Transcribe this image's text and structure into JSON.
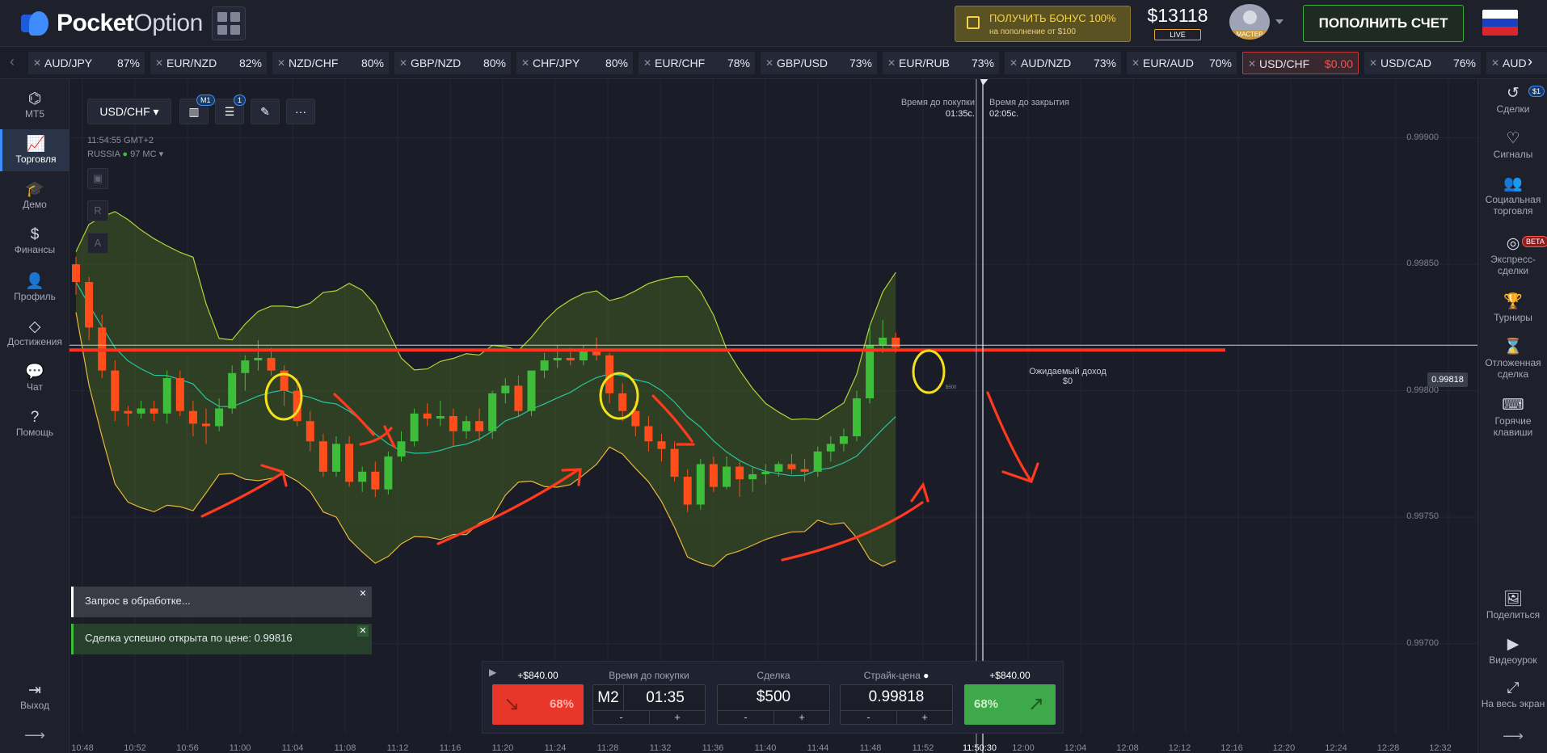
{
  "header": {
    "brand_bold": "Pocket",
    "brand_light": "Option",
    "bonus_line1": "ПОЛУЧИТЬ БОНУС 100%",
    "bonus_line2": "на пополнение от $100",
    "balance": "$13118",
    "account_type": "LIVE",
    "level": "МАСТЕР",
    "deposit_label": "ПОПОЛНИТЬ СЧЕТ"
  },
  "tickers": [
    {
      "pair": "AUD/JPY",
      "payout": "87%"
    },
    {
      "pair": "EUR/NZD",
      "payout": "82%"
    },
    {
      "pair": "NZD/CHF",
      "payout": "80%"
    },
    {
      "pair": "GBP/NZD",
      "payout": "80%"
    },
    {
      "pair": "CHF/JPY",
      "payout": "80%"
    },
    {
      "pair": "EUR/CHF",
      "payout": "78%"
    },
    {
      "pair": "GBP/USD",
      "payout": "73%"
    },
    {
      "pair": "EUR/RUB",
      "payout": "73%"
    },
    {
      "pair": "AUD/NZD",
      "payout": "73%"
    },
    {
      "pair": "EUR/AUD",
      "payout": "70%"
    },
    {
      "pair": "USD/CHF",
      "payout": "$0.00"
    },
    {
      "pair": "USD/CAD",
      "payout": "76%"
    },
    {
      "pair": "AUD",
      "payout": ""
    }
  ],
  "left_nav": [
    {
      "icon": "mt5-icon",
      "label": "MT5"
    },
    {
      "icon": "chart-icon",
      "label": "Торговля"
    },
    {
      "icon": "demo-icon",
      "label": "Демо"
    },
    {
      "icon": "dollar-icon",
      "label": "Финансы"
    },
    {
      "icon": "user-icon",
      "label": "Профиль"
    },
    {
      "icon": "diamond-icon",
      "label": "Достижения"
    },
    {
      "icon": "chat-icon",
      "label": "Чат"
    },
    {
      "icon": "help-icon",
      "label": "Помощь"
    },
    {
      "icon": "exit-icon",
      "label": "Выход"
    }
  ],
  "right_nav": [
    {
      "icon": "history-icon",
      "label": "Сделки"
    },
    {
      "icon": "signals-icon",
      "label": "Сигналы"
    },
    {
      "icon": "social-icon",
      "label": "Социальная торговля"
    },
    {
      "icon": "express-icon",
      "label": "Экспресс-сделки"
    },
    {
      "icon": "trophy-icon",
      "label": "Турниры"
    },
    {
      "icon": "hourglass-icon",
      "label": "Отложенная сделка"
    },
    {
      "icon": "keyboard-icon",
      "label": "Горячие клавиши"
    },
    {
      "icon": "share-icon",
      "label": "Поделиться"
    },
    {
      "icon": "video-icon",
      "label": "Видеоурок"
    },
    {
      "icon": "fullscreen-icon",
      "label": "На весь экран"
    }
  ],
  "badges": {
    "deals": "$1",
    "express": "BETA",
    "timeframe": "M1",
    "indicators": "1"
  },
  "chart": {
    "symbol": "USD/CHF",
    "server_time": "11:54:55 GMT+2",
    "region": "RUSSIA",
    "ping": "97 МС",
    "buy_time_label": "Время до покупки",
    "buy_time": "01:35с.",
    "close_time_label": "Время до закрытия",
    "close_time": "02:05с.",
    "expected_label": "Ожидаемый доход",
    "expected_value": "$0",
    "current_price": "0.99818",
    "price_ticks": [
      "0.99900",
      "0.99850",
      "0.99800",
      "0.99750",
      "0.99700"
    ],
    "time_ticks": [
      "10:48",
      "10:52",
      "10:56",
      "11:00",
      "11:04",
      "11:08",
      "11:12",
      "11:16",
      "11:20",
      "11:24",
      "11:28",
      "11:32",
      "11:36",
      "11:40",
      "11:44",
      "11:48",
      "11:52",
      "11:50:30",
      "12:00",
      "12:04",
      "12:08",
      "12:12",
      "12:16",
      "12:20",
      "12:24",
      "12:28",
      "12:32"
    ],
    "side_buttons": [
      "R",
      "A"
    ],
    "deal_marker": "$500"
  },
  "notifications": {
    "processing": "Запрос в обработке...",
    "success": "Сделка успешно открыта по цене: 0.99816"
  },
  "trade_panel": {
    "sell_profit": "+$840.00",
    "buy_profit": "+$840.00",
    "sell_pct": "68%",
    "buy_pct": "68%",
    "time_label": "Время до покупки",
    "timeframe": "M2",
    "time_value": "01:35",
    "amount_label": "Сделка",
    "amount": "$500",
    "strike_label": "Страйк-цена",
    "strike": "0.99818",
    "minus": "-",
    "plus": "+"
  },
  "colors": {
    "up": "#3ebd3a",
    "down": "#ff4e1c",
    "band": "#4a6a22",
    "bandline": "#b5d33a",
    "midline": "#27c7a0",
    "annotation_red": "#ff3a1f",
    "annotation_yellow": "#f5e11a",
    "price_line": "#ff3320"
  },
  "chart_data": {
    "type": "candlestick",
    "note": "Bollinger bands overlay",
    "candles_ohlc": [
      [
        0.9985,
        0.99853,
        0.99838,
        0.99843
      ],
      [
        0.99843,
        0.99845,
        0.9982,
        0.99825
      ],
      [
        0.99825,
        0.9983,
        0.99805,
        0.99808
      ],
      [
        0.99808,
        0.99812,
        0.99788,
        0.99792
      ],
      [
        0.99792,
        0.99794,
        0.99786,
        0.99791
      ],
      [
        0.99791,
        0.99796,
        0.99789,
        0.99793
      ],
      [
        0.99793,
        0.99796,
        0.99788,
        0.99791
      ],
      [
        0.99791,
        0.99808,
        0.99787,
        0.99805
      ],
      [
        0.99805,
        0.99808,
        0.9979,
        0.99792
      ],
      [
        0.99792,
        0.99796,
        0.99782,
        0.99787
      ],
      [
        0.99787,
        0.99793,
        0.99779,
        0.99786
      ],
      [
        0.99786,
        0.99797,
        0.99784,
        0.99793
      ],
      [
        0.99793,
        0.9981,
        0.99791,
        0.99807
      ],
      [
        0.99807,
        0.99814,
        0.998,
        0.99812
      ],
      [
        0.99812,
        0.9982,
        0.99808,
        0.99813
      ],
      [
        0.99813,
        0.99817,
        0.99806,
        0.99808
      ],
      [
        0.99808,
        0.9981,
        0.99794,
        0.998
      ],
      [
        0.998,
        0.99805,
        0.99786,
        0.99788
      ],
      [
        0.99788,
        0.99792,
        0.99776,
        0.9978
      ],
      [
        0.9978,
        0.99783,
        0.99766,
        0.99768
      ],
      [
        0.99768,
        0.99782,
        0.99766,
        0.99779
      ],
      [
        0.99779,
        0.99782,
        0.99762,
        0.99764
      ],
      [
        0.99764,
        0.9977,
        0.9976,
        0.99768
      ],
      [
        0.99768,
        0.99772,
        0.99758,
        0.99761
      ],
      [
        0.99761,
        0.99776,
        0.99759,
        0.99774
      ],
      [
        0.99774,
        0.99784,
        0.99772,
        0.9978
      ],
      [
        0.9978,
        0.99793,
        0.99778,
        0.99791
      ],
      [
        0.99791,
        0.99795,
        0.99786,
        0.99789
      ],
      [
        0.99789,
        0.99796,
        0.99786,
        0.9979
      ],
      [
        0.9979,
        0.99793,
        0.99778,
        0.99784
      ],
      [
        0.99784,
        0.9979,
        0.99781,
        0.99788
      ],
      [
        0.99788,
        0.99793,
        0.9978,
        0.99784
      ],
      [
        0.99784,
        0.998,
        0.99781,
        0.99799
      ],
      [
        0.99799,
        0.99805,
        0.99795,
        0.99802
      ],
      [
        0.99802,
        0.99806,
        0.9979,
        0.99792
      ],
      [
        0.99792,
        0.99805,
        0.9979,
        0.99808
      ],
      [
        0.99808,
        0.99815,
        0.99805,
        0.99812
      ],
      [
        0.99812,
        0.99818,
        0.99809,
        0.99813
      ],
      [
        0.99813,
        0.99817,
        0.9981,
        0.99812
      ],
      [
        0.99812,
        0.99818,
        0.9981,
        0.99816
      ],
      [
        0.99816,
        0.99821,
        0.99812,
        0.99814
      ],
      [
        0.99814,
        0.99815,
        0.99795,
        0.99799
      ],
      [
        0.99799,
        0.99803,
        0.99788,
        0.99792
      ],
      [
        0.99792,
        0.99796,
        0.99782,
        0.99786
      ],
      [
        0.99786,
        0.9979,
        0.99776,
        0.9978
      ],
      [
        0.9978,
        0.99783,
        0.99772,
        0.99777
      ],
      [
        0.99777,
        0.9978,
        0.99764,
        0.99766
      ],
      [
        0.99766,
        0.99769,
        0.99752,
        0.99755
      ],
      [
        0.99755,
        0.99773,
        0.99753,
        0.99771
      ],
      [
        0.99771,
        0.99774,
        0.9976,
        0.99762
      ],
      [
        0.99762,
        0.99774,
        0.99761,
        0.9977
      ],
      [
        0.9977,
        0.99772,
        0.99758,
        0.99765
      ],
      [
        0.99765,
        0.9977,
        0.9976,
        0.99767
      ],
      [
        0.99767,
        0.99771,
        0.99763,
        0.99768
      ],
      [
        0.99768,
        0.99772,
        0.99766,
        0.99771
      ],
      [
        0.99771,
        0.99775,
        0.99767,
        0.99769
      ],
      [
        0.99769,
        0.99773,
        0.99764,
        0.99768
      ],
      [
        0.99768,
        0.99778,
        0.99766,
        0.99776
      ],
      [
        0.99776,
        0.99782,
        0.99772,
        0.99779
      ],
      [
        0.99779,
        0.99785,
        0.99776,
        0.99782
      ],
      [
        0.99782,
        0.998,
        0.9978,
        0.99797
      ],
      [
        0.99797,
        0.99826,
        0.99795,
        0.99818
      ],
      [
        0.99818,
        0.99828,
        0.99815,
        0.99821
      ],
      [
        0.99821,
        0.99823,
        0.99815,
        0.99817
      ]
    ],
    "ylim": [
      0.9969,
      0.9992
    ]
  }
}
